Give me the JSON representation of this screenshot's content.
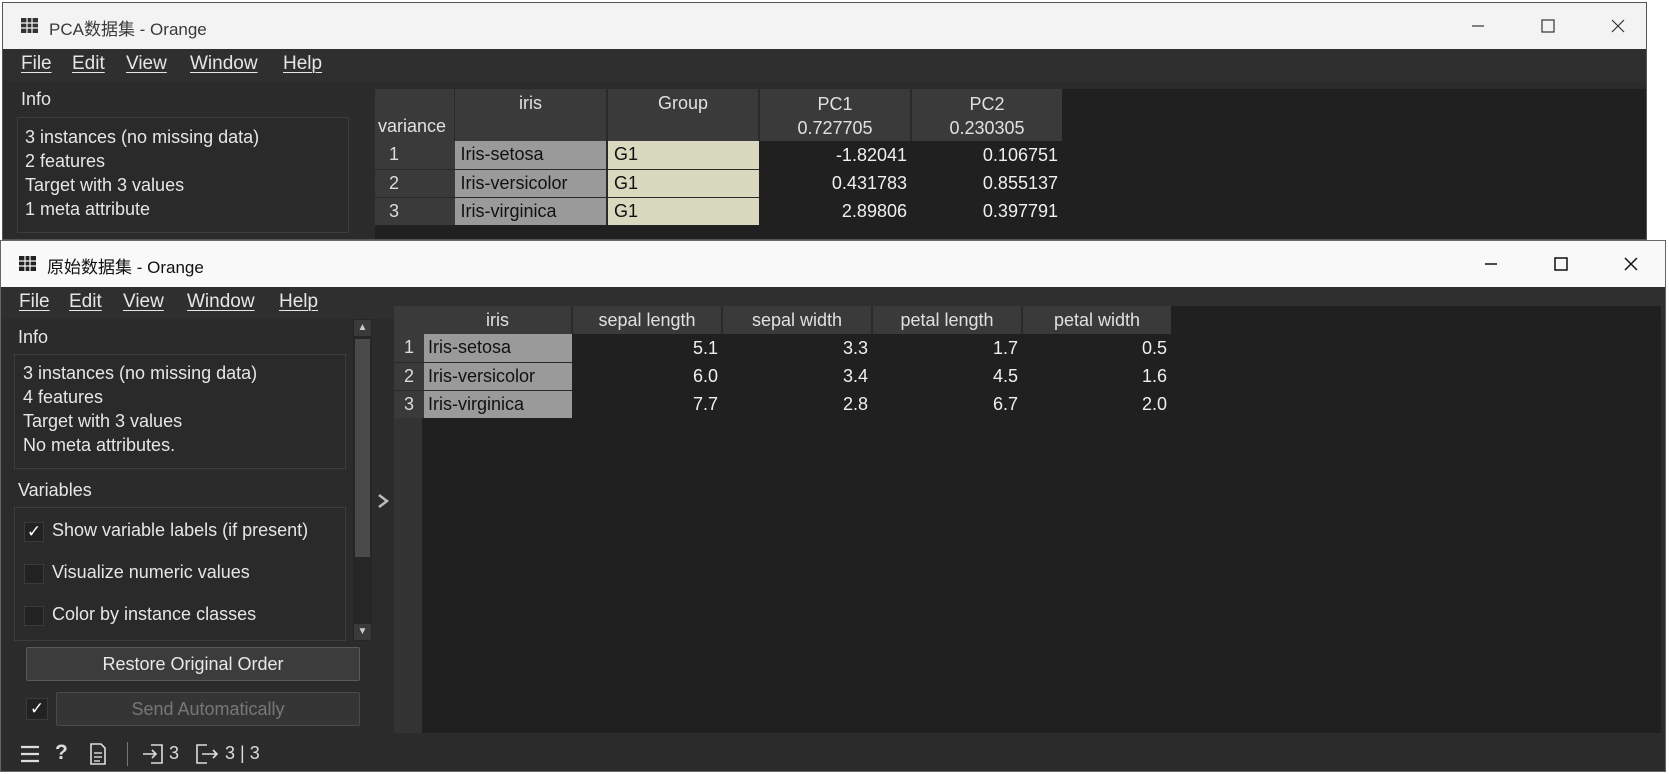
{
  "pca_window": {
    "title": "PCA数据集 - Orange",
    "menu": [
      "File",
      "Edit",
      "View",
      "Window",
      "Help"
    ],
    "info": {
      "heading": "Info",
      "lines": [
        "3 instances (no missing data)",
        "2 features",
        "Target with 3 values",
        "1 meta attribute"
      ]
    },
    "table": {
      "headers": {
        "iris": "iris",
        "group": "Group",
        "pc1": "PC1",
        "pc2": "PC2"
      },
      "variance_label": "variance",
      "variance_values": {
        "pc1": "0.727705",
        "pc2": "0.230305"
      },
      "rows": [
        {
          "num": "1",
          "iris": "Iris-setosa",
          "group": "G1",
          "pc1": "-1.82041",
          "pc2": "0.106751"
        },
        {
          "num": "2",
          "iris": "Iris-versicolor",
          "group": "G1",
          "pc1": "0.431783",
          "pc2": "0.855137"
        },
        {
          "num": "3",
          "iris": "Iris-virginica",
          "group": "G1",
          "pc1": "2.89806",
          "pc2": "0.397791"
        }
      ]
    }
  },
  "orig_window": {
    "title": "原始数据集 - Orange",
    "menu": [
      "File",
      "Edit",
      "View",
      "Window",
      "Help"
    ],
    "info": {
      "heading": "Info",
      "lines": [
        "3 instances (no missing data)",
        "4 features",
        "Target with 3 values",
        "No meta attributes."
      ]
    },
    "variables": {
      "heading": "Variables",
      "options": [
        {
          "label": "Show variable labels (if present)",
          "checked": true
        },
        {
          "label": "Visualize numeric values",
          "checked": false
        },
        {
          "label": "Color by instance classes",
          "checked": false
        }
      ]
    },
    "restore_button": "Restore Original Order",
    "send_auto_button": "Send Automatically",
    "send_auto_checked": true,
    "status": {
      "input_count": "3",
      "output_count": "3 | 3"
    },
    "table": {
      "headers": [
        "iris",
        "sepal length",
        "sepal width",
        "petal length",
        "petal width"
      ],
      "rows": [
        {
          "num": "1",
          "iris": "Iris-setosa",
          "vals": [
            "5.1",
            "3.3",
            "1.7",
            "0.5"
          ]
        },
        {
          "num": "2",
          "iris": "Iris-versicolor",
          "vals": [
            "6.0",
            "3.4",
            "4.5",
            "1.6"
          ]
        },
        {
          "num": "3",
          "iris": "Iris-virginica",
          "vals": [
            "7.7",
            "2.8",
            "6.7",
            "2.0"
          ]
        }
      ]
    }
  }
}
